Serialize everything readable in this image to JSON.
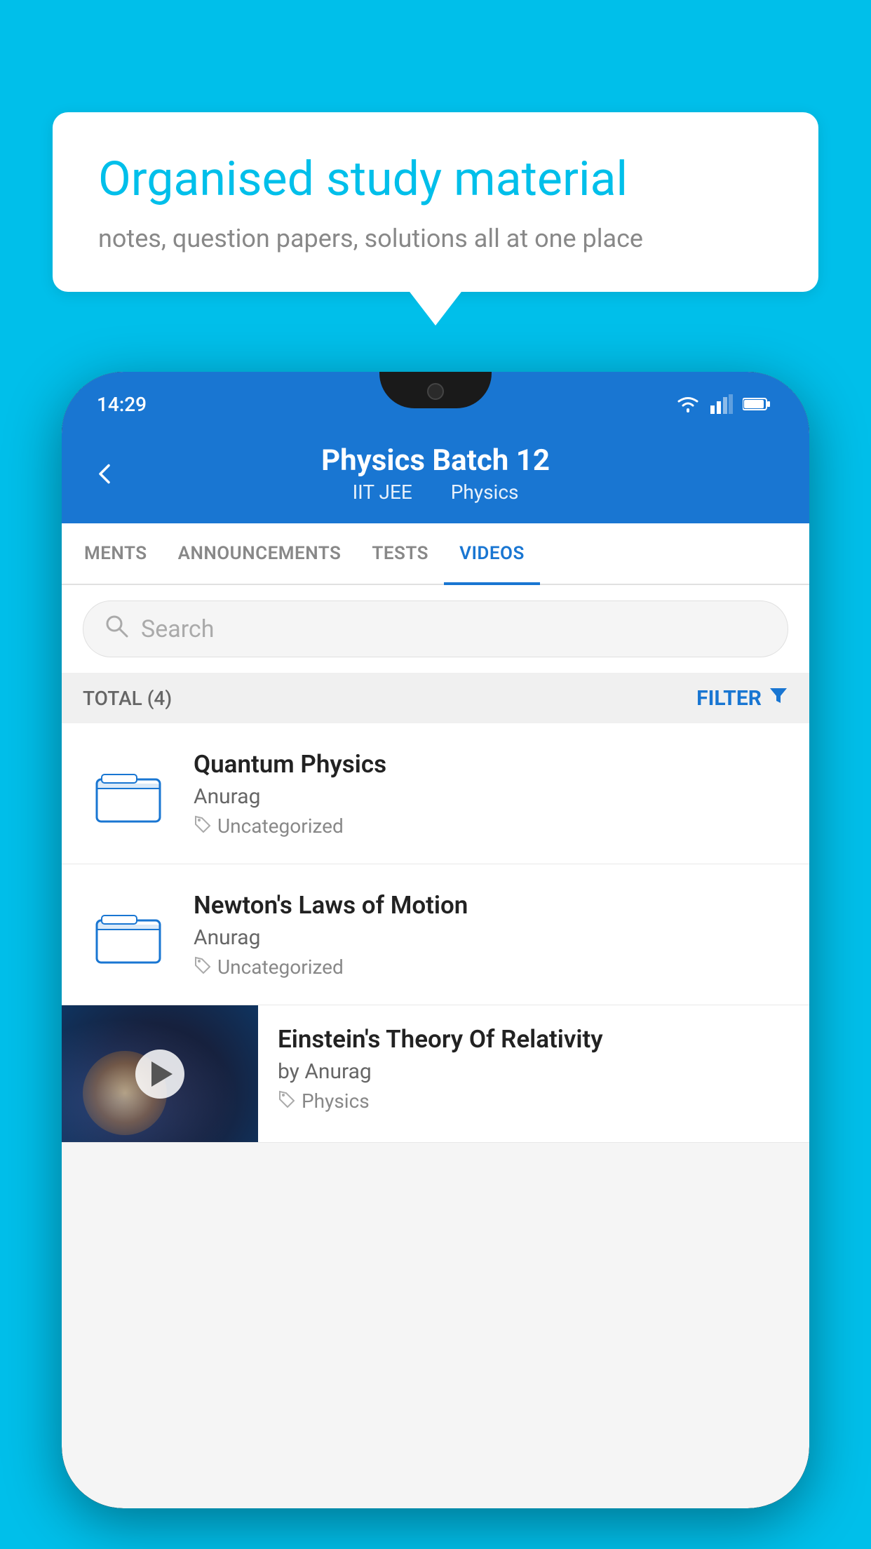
{
  "background_color": "#00BFEA",
  "speech_bubble": {
    "title": "Organised study material",
    "subtitle": "notes, question papers, solutions all at one place"
  },
  "status_bar": {
    "time": "14:29"
  },
  "app_header": {
    "title": "Physics Batch 12",
    "subtitle_part1": "IIT JEE",
    "subtitle_part2": "Physics",
    "back_label": "←"
  },
  "tabs": [
    {
      "label": "MENTS",
      "active": false
    },
    {
      "label": "ANNOUNCEMENTS",
      "active": false
    },
    {
      "label": "TESTS",
      "active": false
    },
    {
      "label": "VIDEOS",
      "active": true
    }
  ],
  "search": {
    "placeholder": "Search"
  },
  "filter_bar": {
    "total_label": "TOTAL (4)",
    "filter_label": "FILTER"
  },
  "videos": [
    {
      "id": 1,
      "title": "Quantum Physics",
      "author": "Anurag",
      "tag": "Uncategorized",
      "has_thumbnail": false
    },
    {
      "id": 2,
      "title": "Newton's Laws of Motion",
      "author": "Anurag",
      "tag": "Uncategorized",
      "has_thumbnail": false
    },
    {
      "id": 3,
      "title": "Einstein's Theory Of Relativity",
      "author": "by Anurag",
      "tag": "Physics",
      "has_thumbnail": true
    }
  ]
}
